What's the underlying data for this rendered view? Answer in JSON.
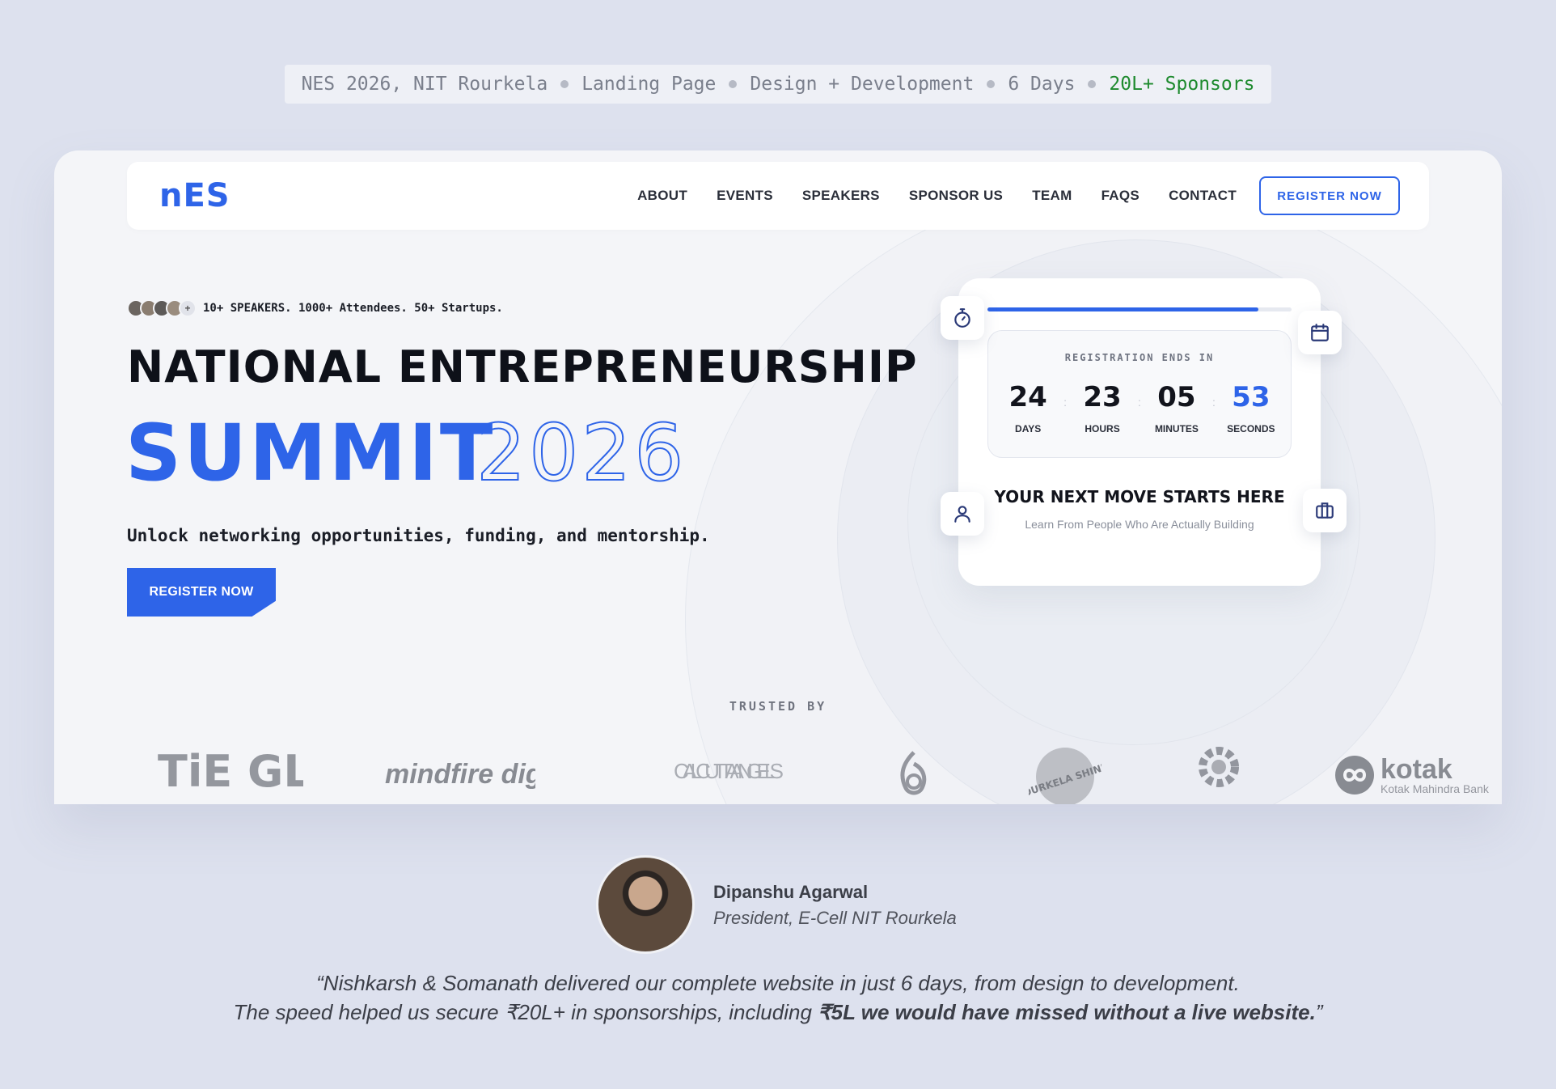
{
  "meta": {
    "items": [
      "NES 2026, NIT Rourkela",
      "Landing Page",
      "Design + Development",
      "6 Days"
    ],
    "highlight": "20L+ Sponsors"
  },
  "nav": {
    "logo": "nES",
    "links": [
      "ABOUT",
      "EVENTS",
      "SPEAKERS",
      "SPONSOR US",
      "TEAM",
      "FAQS",
      "CONTACT"
    ],
    "cta": "REGISTER NOW"
  },
  "hero": {
    "stats": "10+ SPEAKERS. 1000+ Attendees. 50+ Startups.",
    "title_line1": "NATIONAL ENTREPRENEURSHIP",
    "title_summit": "SUMMIT",
    "title_year": "2026",
    "subtitle": "Unlock networking opportunities, funding, and mentorship.",
    "cta": "REGISTER NOW"
  },
  "countdown": {
    "label": "REGISTRATION ENDS IN",
    "progress": 0.89,
    "units": [
      {
        "value": "24",
        "label": "DAYS"
      },
      {
        "value": "23",
        "label": "HOURS"
      },
      {
        "value": "05",
        "label": "MINUTES"
      },
      {
        "value": "53",
        "label": "SECONDS"
      }
    ],
    "headline": "YOUR NEXT MOVE STARTS HERE",
    "sub": "Learn From People Who Are Actually Building"
  },
  "trusted": {
    "label": "TRUSTED BY",
    "logos": [
      "TiE GLOBAL",
      "mindfire digital",
      "CALCUTTA ANGELS",
      "ROURKELA SHINES",
      "kotak",
      "Kotak Mahindra Bank"
    ]
  },
  "testimonial": {
    "name": "Dipanshu Agarwal",
    "role": "President, E-Cell NIT Rourkela",
    "line1": "“Nishkarsh & Somanath delivered our complete website in just 6 days, from design to development.",
    "line2_normal": "The speed helped us secure ₹20L+ in sponsorships, including ",
    "line2_bold": "₹5L we would have missed without a live website.",
    "line2_end": "”"
  },
  "colors": {
    "accent": "#2e64e8",
    "background": "#dde1ee",
    "highlight_green": "#1e8a2e"
  },
  "icons": [
    "stopwatch-icon",
    "calendar-icon",
    "user-icon",
    "briefcase-icon"
  ]
}
